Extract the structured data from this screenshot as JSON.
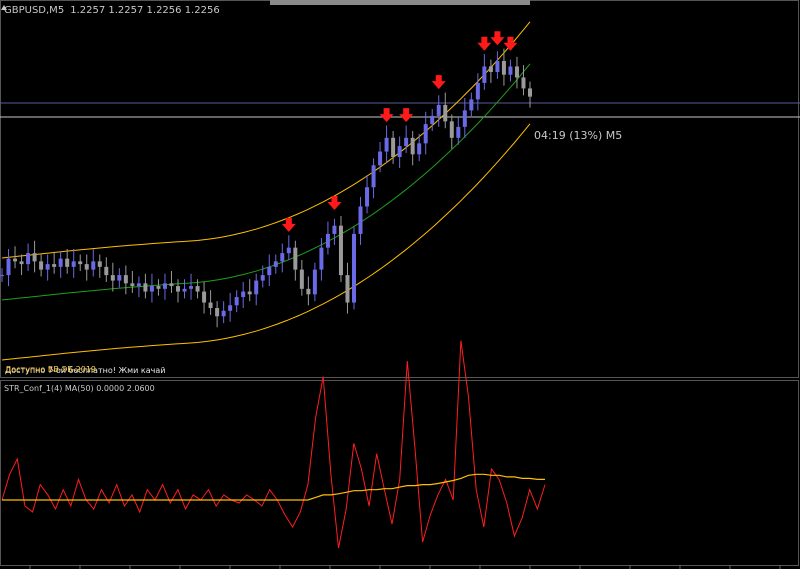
{
  "main_window": {
    "symbol_header": "GBPUSD,M5",
    "ohlc_header": "1.2257 1.2257 1.2256 1.2256",
    "countdown_label": "04:19 (13%) M5",
    "overlap_text_1": "Доступно 7-ой бесплатно! Жми качай",
    "overlap_text_2": "Доступно БВ-ЭБ-2019"
  },
  "indicator_window": {
    "header": "STR_Conf_1(4) MA(50) 0.0000 2.0600"
  },
  "colors": {
    "background": "#000000",
    "bull_candle": "#6a6ae6",
    "bear_candle": "#9a9a9a",
    "upper_band": "#ffc000",
    "mid_band": "#1ea01e",
    "lower_band": "#ffc000",
    "signal_arrow": "#ff1a1a",
    "osc_line": "#ff1e1e",
    "osc_ma": "#ffc000",
    "hline": "#6a6a9a"
  },
  "chart_data": [
    {
      "type": "candlestick",
      "title": "GBPUSD,M5",
      "price_path": [
        0.3,
        0.36,
        0.35,
        0.34,
        0.38,
        0.35,
        0.32,
        0.34,
        0.33,
        0.36,
        0.33,
        0.35,
        0.34,
        0.32,
        0.35,
        0.33,
        0.3,
        0.28,
        0.3,
        0.27,
        0.26,
        0.27,
        0.24,
        0.26,
        0.25,
        0.27,
        0.26,
        0.24,
        0.25,
        0.26,
        0.24,
        0.2,
        0.18,
        0.15,
        0.17,
        0.19,
        0.22,
        0.24,
        0.23,
        0.28,
        0.3,
        0.33,
        0.35,
        0.38,
        0.4,
        0.32,
        0.25,
        0.23,
        0.32,
        0.4,
        0.45,
        0.48,
        0.3,
        0.2,
        0.45,
        0.55,
        0.62,
        0.7,
        0.75,
        0.8,
        0.73,
        0.77,
        0.8,
        0.74,
        0.78,
        0.85,
        0.88,
        0.92,
        0.86,
        0.8,
        0.84,
        0.9,
        0.94,
        1.0,
        1.06,
        1.04,
        1.08,
        1.03,
        1.06,
        1.02,
        0.98,
        0.95
      ],
      "signal_arrows_at_peaks": 8,
      "bands": [
        "upper",
        "middle",
        "lower"
      ]
    },
    {
      "type": "line",
      "title": "STR_Conf_1(4) MA(50)",
      "series": [
        {
          "name": "STR_Conf_1(4)",
          "values": [
            0.0,
            0.5,
            0.8,
            -0.2,
            -0.4,
            0.3,
            0.1,
            -0.3,
            0.2,
            -0.2,
            0.4,
            0.0,
            -0.3,
            0.2,
            -0.1,
            0.3,
            -0.2,
            0.1,
            -0.4,
            0.2,
            0.0,
            0.3,
            -0.1,
            0.2,
            -0.3,
            0.1,
            0.0,
            0.2,
            -0.2,
            0.1,
            0.0,
            -0.1,
            0.1,
            0.0,
            -0.2,
            0.2,
            0.0,
            -0.5,
            -0.9,
            -0.4,
            0.3,
            1.6,
            2.4,
            0.5,
            -1.6,
            -0.3,
            1.1,
            0.6,
            -0.2,
            0.9,
            0.2,
            -0.8,
            0.4,
            2.7,
            1.0,
            -1.4,
            -0.5,
            0.1,
            0.4,
            0.0,
            3.1,
            2.0,
            0.2,
            -0.9,
            0.6,
            0.4,
            -0.1,
            -1.2,
            -0.6,
            0.2,
            -0.3,
            0.3
          ],
          "color": "#ff1e1e"
        },
        {
          "name": "MA(50)",
          "values": [
            0.0,
            0.0,
            0.0,
            0.0,
            0.0,
            0.0,
            0.0,
            0.0,
            0.0,
            0.0,
            0.0,
            0.0,
            0.0,
            0.0,
            0.0,
            0.0,
            0.0,
            0.0,
            0.0,
            0.0,
            0.0,
            0.0,
            0.0,
            0.0,
            0.0,
            0.0,
            0.0,
            0.0,
            0.0,
            0.0,
            0.0,
            0.0,
            0.0,
            0.0,
            0.0,
            0.0,
            0.0,
            0.0,
            0.0,
            0.0,
            0.0,
            0.05,
            0.1,
            0.1,
            0.12,
            0.15,
            0.18,
            0.18,
            0.2,
            0.2,
            0.22,
            0.22,
            0.25,
            0.28,
            0.28,
            0.3,
            0.3,
            0.32,
            0.35,
            0.38,
            0.42,
            0.48,
            0.5,
            0.5,
            0.48,
            0.48,
            0.45,
            0.45,
            0.42,
            0.42,
            0.4,
            0.4
          ],
          "color": "#ffc000"
        }
      ],
      "ylim": [
        -2,
        2.1
      ]
    }
  ]
}
